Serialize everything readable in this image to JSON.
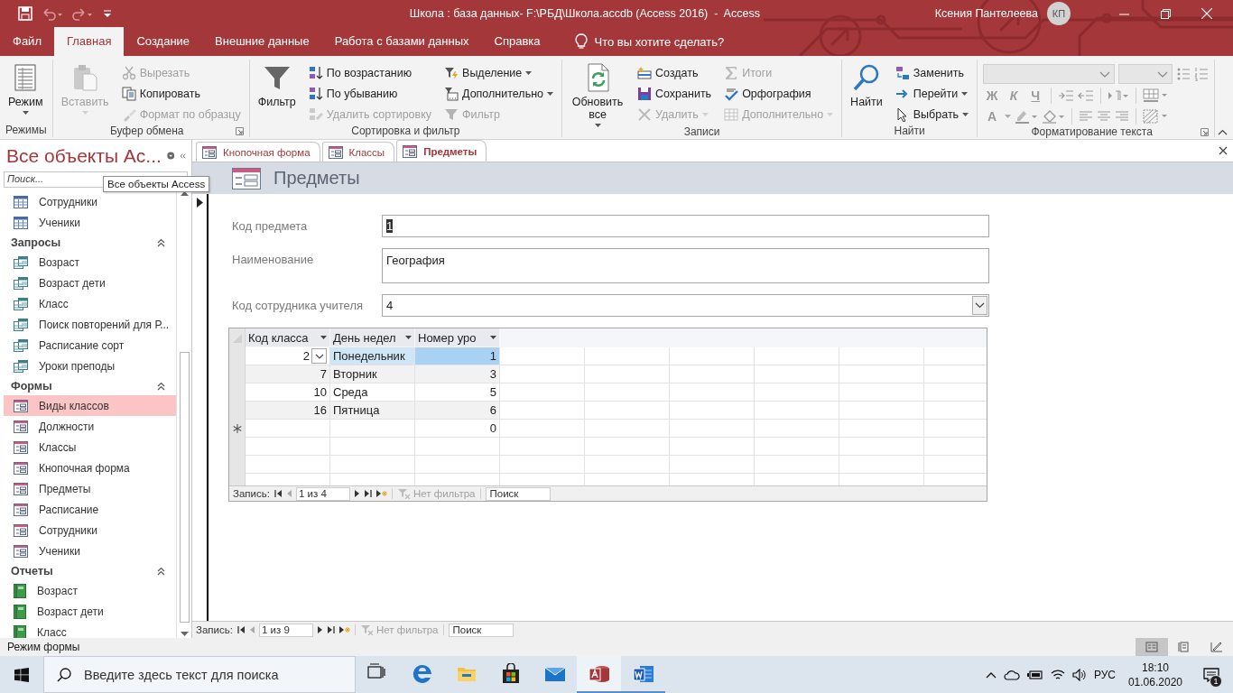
{
  "window": {
    "title": "Школа : база данных- F:\\РБД\\Школа.accdb (Access 2016)  -  Access",
    "user": "Ксения Пантелеева",
    "initials": "КП"
  },
  "menu_tabs": [
    {
      "label": "Файл",
      "selected": false
    },
    {
      "label": "Главная",
      "selected": true
    },
    {
      "label": "Создание",
      "selected": false
    },
    {
      "label": "Внешние данные",
      "selected": false
    },
    {
      "label": "Работа с базами данных",
      "selected": false
    },
    {
      "label": "Справка",
      "selected": false
    }
  ],
  "tell_me": "Что вы хотите сделать?",
  "ribbon": [
    {
      "label": "Режимы",
      "launcher": false,
      "columns": [
        [
          {
            "label": "Режим",
            "kind": "large",
            "disabled": false,
            "dropdown": true
          }
        ]
      ]
    },
    {
      "label": "Буфер обмена",
      "launcher": true,
      "columns": [
        [
          {
            "label": "Вставить",
            "kind": "large",
            "disabled": true,
            "dropdown": true
          }
        ],
        [
          {
            "label": "Вырезать",
            "kind": "small",
            "disabled": true,
            "dropdown": false
          },
          {
            "label": "Копировать",
            "kind": "small",
            "disabled": false,
            "dropdown": false
          },
          {
            "label": "Формат по образцу",
            "kind": "small",
            "disabled": true,
            "dropdown": false
          }
        ]
      ]
    },
    {
      "label": "Сортировка и фильтр",
      "launcher": false,
      "columns": [
        [
          {
            "label": "Фильтр",
            "kind": "large",
            "disabled": false,
            "dropdown": false
          }
        ],
        [
          {
            "label": "По возрастанию",
            "kind": "small",
            "disabled": false,
            "dropdown": false
          },
          {
            "label": "По убыванию",
            "kind": "small",
            "disabled": false,
            "dropdown": false
          },
          {
            "label": "Удалить сортировку",
            "kind": "small",
            "disabled": true,
            "dropdown": false
          }
        ],
        [
          {
            "label": "Выделение",
            "kind": "small",
            "disabled": false,
            "dropdown": true
          },
          {
            "label": "Дополнительно",
            "kind": "small",
            "disabled": false,
            "dropdown": true
          },
          {
            "label": "Фильтр",
            "kind": "small",
            "disabled": true,
            "dropdown": false
          }
        ]
      ]
    },
    {
      "label": "Записи",
      "launcher": false,
      "columns": [
        [
          {
            "label": "Обновить все",
            "kind": "large",
            "disabled": false,
            "dropdown": true
          }
        ],
        [
          {
            "label": "Создать",
            "kind": "small",
            "disabled": false,
            "dropdown": false
          },
          {
            "label": "Сохранить",
            "kind": "small",
            "disabled": false,
            "dropdown": false
          },
          {
            "label": "Удалить",
            "kind": "small",
            "disabled": true,
            "dropdown": true
          }
        ],
        [
          {
            "label": "Итоги",
            "kind": "small",
            "disabled": true,
            "dropdown": false
          },
          {
            "label": "Орфография",
            "kind": "small",
            "disabled": false,
            "dropdown": false
          },
          {
            "label": "Дополнительно",
            "kind": "small",
            "disabled": true,
            "dropdown": true
          }
        ]
      ]
    },
    {
      "label": "Найти",
      "launcher": false,
      "columns": [
        [
          {
            "label": "Найти",
            "kind": "large",
            "disabled": false,
            "dropdown": false
          }
        ],
        [
          {
            "label": "Заменить",
            "kind": "small",
            "disabled": false,
            "dropdown": false
          },
          {
            "label": "Перейти",
            "kind": "small",
            "disabled": false,
            "dropdown": true
          },
          {
            "label": "Выбрать",
            "kind": "small",
            "disabled": false,
            "dropdown": true
          }
        ]
      ]
    }
  ],
  "text_format": {
    "label": "Форматирование текста",
    "launcher": true,
    "disabled": true,
    "letters": [
      "Ж",
      "К",
      "Ч"
    ],
    "font_color": "A"
  },
  "nav": {
    "title": "Все объекты Ас...",
    "search_placeholder": "Поиск...",
    "tooltip": "Все объекты Access",
    "groups": [
      {
        "kind": "table",
        "items": [
          {
            "label": "Сотрудники",
            "selected": false
          },
          {
            "label": "Ученики",
            "selected": false
          }
        ]
      },
      {
        "title": "Запросы",
        "kind": "query",
        "items": [
          {
            "label": "Возраст",
            "selected": false
          },
          {
            "label": "Возраст дети",
            "selected": false
          },
          {
            "label": "Класс",
            "selected": false
          },
          {
            "label": "Поиск повторений для Р...",
            "selected": false
          },
          {
            "label": "Расписание сорт",
            "selected": false
          },
          {
            "label": "Уроки преподы",
            "selected": false
          }
        ]
      },
      {
        "title": "Формы",
        "kind": "form",
        "items": [
          {
            "label": "Виды классов",
            "selected": true
          },
          {
            "label": "Должности",
            "selected": false
          },
          {
            "label": "Классы",
            "selected": false
          },
          {
            "label": "Кнопочная форма",
            "selected": false
          },
          {
            "label": "Предметы",
            "selected": false
          },
          {
            "label": "Расписание",
            "selected": false
          },
          {
            "label": "Сотрудники",
            "selected": false
          },
          {
            "label": "Ученики",
            "selected": false
          }
        ]
      },
      {
        "title": "Отчеты",
        "kind": "report",
        "items": [
          {
            "label": "Возраст",
            "selected": false
          },
          {
            "label": "Возраст дети",
            "selected": false
          },
          {
            "label": "Класс",
            "selected": false
          }
        ]
      }
    ]
  },
  "document_tabs": [
    {
      "label": "Кнопочная форма",
      "selected": false
    },
    {
      "label": "Классы",
      "selected": false
    },
    {
      "label": "Предметы",
      "selected": true
    }
  ],
  "form": {
    "title": "Предметы",
    "fields": [
      {
        "label": "Код предмета",
        "value": "1",
        "kind": "text",
        "focused": true
      },
      {
        "label": "Наименование",
        "value": "География",
        "kind": "memo",
        "focused": false
      },
      {
        "label": "Код сотрудника учителя",
        "value": "4",
        "kind": "combo",
        "focused": false
      }
    ],
    "subform": {
      "columns": [
        "Код класса",
        "День недел",
        "Номер уро"
      ],
      "rows": [
        {
          "cells": [
            "2",
            "Понедельник",
            "1"
          ],
          "current": true
        },
        {
          "cells": [
            "7",
            "Вторник",
            "3"
          ],
          "current": false
        },
        {
          "cells": [
            "10",
            "Среда",
            "5"
          ],
          "current": false
        },
        {
          "cells": [
            "16",
            "Пятница",
            "6"
          ],
          "current": false
        }
      ],
      "new_row_default": "0",
      "record_nav": {
        "label": "Запись:",
        "position": "1 из 4",
        "filter": "Нет фильтра",
        "search": "Поиск"
      }
    },
    "record_nav": {
      "label": "Запись:",
      "position": "1 из 9",
      "filter": "Нет фильтра",
      "search": "Поиск"
    }
  },
  "status_bar": {
    "text": "Режим формы",
    "views": [
      {
        "selected": true
      },
      {
        "selected": false
      },
      {
        "selected": false
      }
    ]
  },
  "taskbar": {
    "search_placeholder": "Введите здесь текст для поиска",
    "apps": [
      {
        "kind": "taskview",
        "running": false,
        "selected": false
      },
      {
        "kind": "edge",
        "running": false,
        "selected": false
      },
      {
        "kind": "explorer",
        "running": false,
        "selected": false
      },
      {
        "kind": "store",
        "running": false,
        "selected": false
      },
      {
        "kind": "mail",
        "running": false,
        "selected": false
      },
      {
        "kind": "access",
        "running": true,
        "selected": true
      },
      {
        "kind": "word",
        "running": true,
        "selected": false
      }
    ],
    "language": "РУС",
    "time": "18:10",
    "date": "01.06.2020",
    "notifications": "1"
  }
}
